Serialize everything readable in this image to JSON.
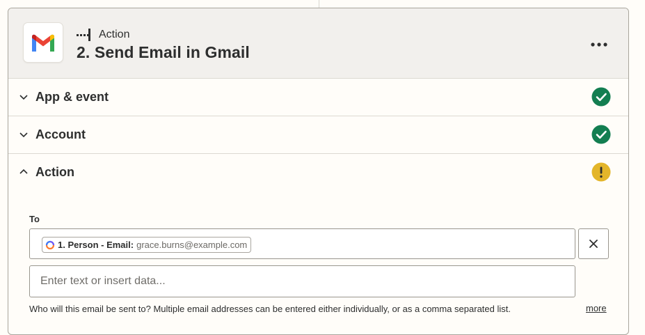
{
  "step": {
    "type_label": "Action",
    "title": "2. Send Email in Gmail",
    "app_icon": "gmail-logo",
    "more_icon": "more-horizontal-icon"
  },
  "sections": [
    {
      "label": "App & event",
      "state": "collapsed",
      "status": "complete",
      "status_color": "#137e51"
    },
    {
      "label": "Account",
      "state": "collapsed",
      "status": "complete",
      "status_color": "#137e51"
    },
    {
      "label": "Action",
      "state": "expanded",
      "status": "warning",
      "status_color": "#e3b52a"
    }
  ],
  "to_field": {
    "label": "To",
    "token": {
      "label": "1. Person - Email:",
      "value": "grace.burns@example.com",
      "icon": "step-1-icon"
    },
    "clear_icon": "close-icon",
    "placeholder": "Enter text or insert data...",
    "help_text": "Who will this email be sent to? Multiple email addresses can be entered either individually, or as a comma separated list.",
    "more_label": "more"
  }
}
